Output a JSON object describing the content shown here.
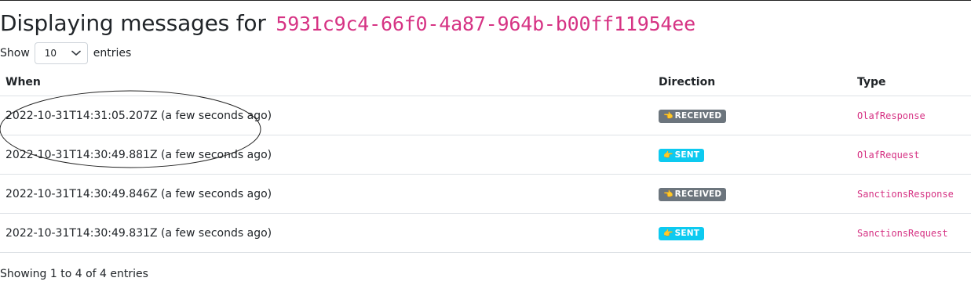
{
  "header": {
    "title_prefix": "Displaying messages for",
    "correlation_id": "5931c9c4-66f0-4a87-964b-b00ff11954ee"
  },
  "length_menu": {
    "show_label": "Show",
    "selected": "10",
    "entries_label": "entries"
  },
  "table": {
    "columns": [
      "When",
      "Direction",
      "Type"
    ],
    "rows": [
      {
        "when": "2022-10-31T14:31:05.207Z (a few seconds ago)",
        "direction": "RECEIVED",
        "type": "OlafResponse"
      },
      {
        "when": "2022-10-31T14:30:49.881Z (a few seconds ago)",
        "direction": "SENT",
        "type": "OlafRequest"
      },
      {
        "when": "2022-10-31T14:30:49.846Z (a few seconds ago)",
        "direction": "RECEIVED",
        "type": "SanctionsResponse"
      },
      {
        "when": "2022-10-31T14:30:49.831Z (a few seconds ago)",
        "direction": "SENT",
        "type": "SanctionsRequest"
      }
    ]
  },
  "footer": {
    "info": "Showing 1 to 4 of 4 entries"
  },
  "icons": {
    "received": "hand-pointing-left-icon",
    "sent": "hand-pointing-right-icon"
  },
  "colors": {
    "accent_code": "#d63384",
    "badge_received": "#6c757d",
    "badge_sent": "#0dcaf0"
  }
}
